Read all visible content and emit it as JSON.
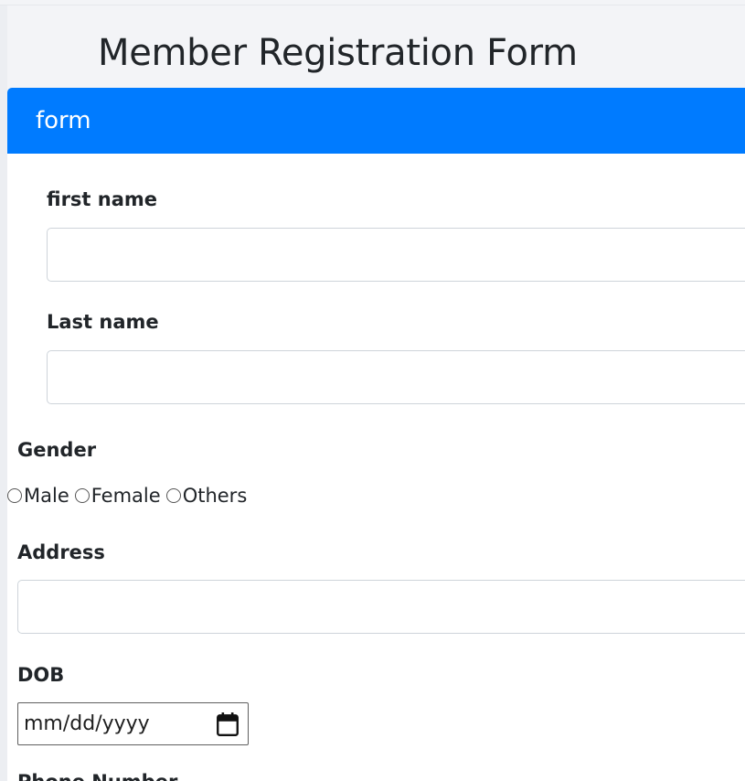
{
  "page": {
    "title": "Member Registration Form"
  },
  "card": {
    "header": "form"
  },
  "fields": {
    "first_name": {
      "label": "first name",
      "value": ""
    },
    "last_name": {
      "label": "Last name",
      "value": ""
    },
    "gender": {
      "label": "Gender",
      "options": [
        "Male",
        "Female",
        "Others"
      ],
      "selected": ""
    },
    "address": {
      "label": "Address",
      "value": ""
    },
    "dob": {
      "label": "DOB",
      "placeholder": "mm/dd/yyyy"
    },
    "phone": {
      "label": "Phone Number"
    }
  },
  "icons": {
    "dob_picker": "calendar-icon"
  },
  "colors": {
    "header_bg": "#007bff",
    "header_text": "#ffffff",
    "page_bg": "#f3f4f7"
  }
}
